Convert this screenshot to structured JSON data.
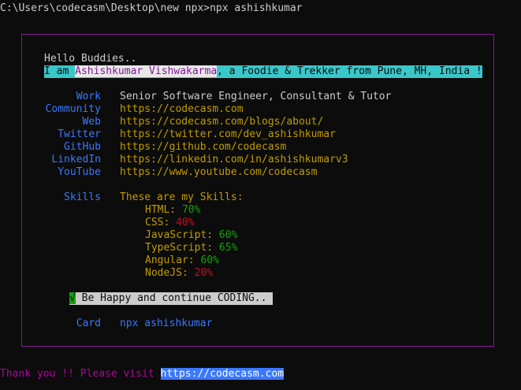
{
  "terminal": {
    "prompt_line": "C:\\Users\\codecasm\\Desktop\\new npx>npx ashishkumar"
  },
  "card": {
    "greeting": "Hello Buddies..",
    "intro_prefix": "I am ",
    "intro_name": "Ashishkumar Vishwakarma",
    "intro_suffix": ", a Foodie & Trekker from Pune, MH, India !",
    "rows": [
      {
        "label": "Work",
        "value": "Senior Software Engineer, Consultant & Tutor"
      },
      {
        "label": "Community",
        "value": "https://codecasm.com"
      },
      {
        "label": "Web",
        "value": "https://codecasm.com/blogs/about/"
      },
      {
        "label": "Twitter",
        "value": "https://twitter.com/dev_ashishkumar"
      },
      {
        "label": "GitHub",
        "value": "https://github.com/codecasm"
      },
      {
        "label": "LinkedIn",
        "value": "https://linkedin.com/in/ashishkumarv3"
      },
      {
        "label": "YouTube",
        "value": "https://www.youtube.com/codecasm"
      }
    ],
    "skills_label": "Skills",
    "skills_intro": "These are my Skills:",
    "skills": [
      {
        "name": "HTML: ",
        "level": "70%",
        "color": "#13a10e"
      },
      {
        "name": "CSS: ",
        "level": "40%",
        "color": "#c50f1f"
      },
      {
        "name": "JavaScript: ",
        "level": "60%",
        "color": "#13a10e"
      },
      {
        "name": "TypeScript: ",
        "level": "65%",
        "color": "#13a10e"
      },
      {
        "name": "Angular: ",
        "level": "60%",
        "color": "#13a10e"
      },
      {
        "name": "NodeJS: ",
        "level": "20%",
        "color": "#c50f1f"
      }
    ],
    "check_mark": "√",
    "happy_text": " Be Happy and continue CODING.. ",
    "card_label": "Card",
    "card_value": "npx ashishkumar"
  },
  "footer": {
    "thanks_text": "Thank you !! Please visit ",
    "link": "https://codecasm.com"
  },
  "colors": {
    "background": "#0c0c0c",
    "border": "#881798",
    "label_blue": "#3b78ff",
    "value_yellow": "#c19c00",
    "green": "#13a10e",
    "red": "#c50f1f",
    "cyan_highlight": "#3ac7c9"
  }
}
